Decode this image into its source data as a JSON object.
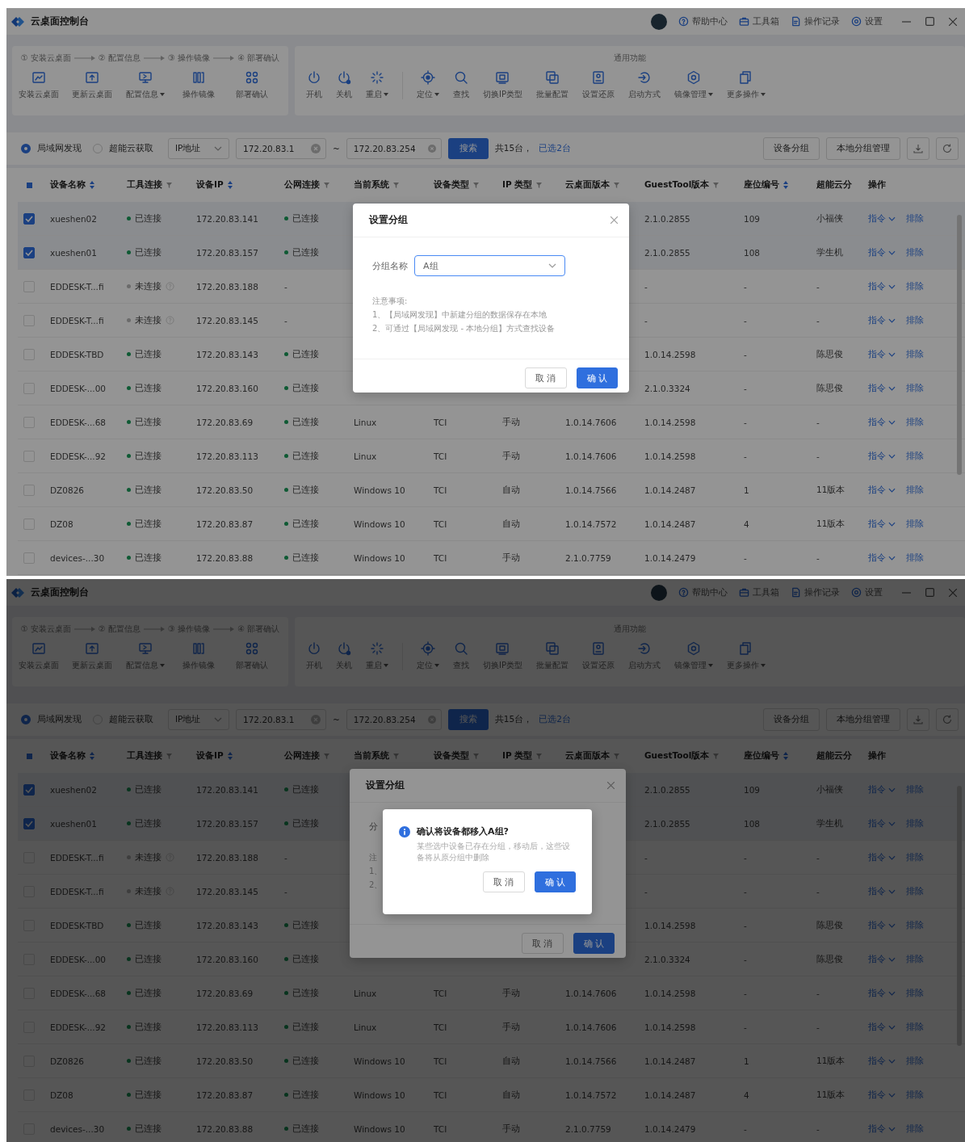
{
  "screens": [
    {
      "window": {
        "title": "云桌面控制台",
        "links": [
          "帮助中心",
          "工具箱",
          "操作记录",
          "设置"
        ]
      },
      "deploy": {
        "steps": [
          "① 安装云桌面",
          "② 配置信息",
          "③ 操作镜像",
          "④ 部署确认"
        ],
        "buttons": [
          {
            "label": "安装云桌面",
            "dropdown": false
          },
          {
            "label": "更新云桌面",
            "dropdown": false
          },
          {
            "label": "配置信息",
            "dropdown": true
          },
          {
            "label": "操作镜像",
            "dropdown": false
          },
          {
            "label": "部署确认",
            "dropdown": false
          }
        ]
      },
      "common": {
        "title": "通用功能",
        "groups": [
          [
            {
              "label": "开机",
              "dropdown": false
            },
            {
              "label": "关机",
              "dropdown": false
            },
            {
              "label": "重启",
              "dropdown": true
            }
          ],
          [
            {
              "label": "定位",
              "dropdown": true
            },
            {
              "label": "查找",
              "dropdown": false
            },
            {
              "label": "切换IP类型",
              "dropdown": false
            },
            {
              "label": "批量配置",
              "dropdown": false
            },
            {
              "label": "设置还原",
              "dropdown": false
            },
            {
              "label": "启动方式",
              "dropdown": false
            },
            {
              "label": "镜像管理",
              "dropdown": true
            },
            {
              "label": "更多操作",
              "dropdown": true
            }
          ]
        ]
      },
      "filter": {
        "sources": [
          {
            "label": "局域网发现",
            "selected": true
          },
          {
            "label": "超能云获取",
            "selected": false
          }
        ],
        "field": "IP地址",
        "ip_from": "172.20.83.1",
        "separator": "~",
        "ip_to": "172.20.83.254",
        "search": "搜索",
        "total": "共15台，",
        "selected_count": "已选2台",
        "buttons": [
          "设备分组",
          "本地分组管理"
        ]
      },
      "table": {
        "header_indeterminate": true,
        "columns": [
          {
            "label": "设备名称",
            "kind": "sort"
          },
          {
            "label": "工具连接",
            "kind": "filter"
          },
          {
            "label": "设备IP",
            "kind": "sort"
          },
          {
            "label": "公网连接",
            "kind": "filter"
          },
          {
            "label": "当前系统",
            "kind": "filter"
          },
          {
            "label": "设备类型",
            "kind": "filter"
          },
          {
            "label": "IP 类型",
            "kind": "filter"
          },
          {
            "label": "云桌面版本",
            "kind": "filter"
          },
          {
            "label": "GuestTool版本",
            "kind": "filter"
          },
          {
            "label": "座位编号",
            "kind": "sort"
          },
          {
            "label": "超能云分",
            "kind": "plain"
          },
          {
            "label": "操作",
            "kind": "plain"
          }
        ],
        "rows": [
          {
            "selected": true,
            "name": "xueshen02",
            "tool": {
              "label": "已连接",
              "kind": "connected"
            },
            "ip": "172.20.83.141",
            "public": {
              "label": "已连接",
              "kind": "connected"
            },
            "guest_tool": "2.1.0.2855",
            "seat": "109",
            "cloud_group": "小福侠",
            "actions": [
              "指令",
              "排除"
            ]
          },
          {
            "selected": true,
            "name": "xueshen01",
            "tool": {
              "label": "已连接",
              "kind": "connected"
            },
            "ip": "172.20.83.157",
            "public": {
              "label": "已连接",
              "kind": "connected"
            },
            "guest_tool": "2.1.0.2855",
            "seat": "108",
            "cloud_group": "学生机",
            "actions": [
              "指令",
              "排除"
            ]
          },
          {
            "selected": false,
            "name": "EDDESK-T...fi",
            "tool": {
              "label": "未连接",
              "kind": "disconnected"
            },
            "ip": "172.20.83.188",
            "public": {
              "label": "-",
              "kind": "none"
            },
            "guest_tool": "-",
            "seat": "-",
            "cloud_group": "-",
            "actions": [
              "指令",
              "排除"
            ]
          },
          {
            "selected": false,
            "name": "EDDESK-T...fi",
            "tool": {
              "label": "未连接",
              "kind": "disconnected"
            },
            "ip": "172.20.83.145",
            "public": {
              "label": "-",
              "kind": "none"
            },
            "guest_tool": "-",
            "seat": "-",
            "cloud_group": "-",
            "actions": [
              "指令",
              "排除"
            ]
          },
          {
            "selected": false,
            "name": "EDDESK-TBD",
            "tool": {
              "label": "已连接",
              "kind": "connected"
            },
            "ip": "172.20.83.143",
            "public": {
              "label": "已连接",
              "kind": "connected"
            },
            "guest_tool": "1.0.14.2598",
            "seat": "-",
            "cloud_group": "陈思俊",
            "actions": [
              "指令",
              "排除"
            ]
          },
          {
            "selected": false,
            "name": "EDDESK-...00",
            "tool": {
              "label": "已连接",
              "kind": "connected"
            },
            "ip": "172.20.83.160",
            "public": {
              "label": "已连接",
              "kind": "connected"
            },
            "guest_tool": "2.1.0.3324",
            "seat": "-",
            "cloud_group": "陈思俊",
            "actions": [
              "指令",
              "排除"
            ]
          },
          {
            "selected": false,
            "name": "EDDESK-...68",
            "tool": {
              "label": "已连接",
              "kind": "connected"
            },
            "ip": "172.20.83.69",
            "public": {
              "label": "已连接",
              "kind": "connected"
            },
            "system": "Linux",
            "type": "TCI",
            "ip_type": "手动",
            "version": "1.0.14.7606",
            "guest_tool": "1.0.14.2598",
            "seat": "-",
            "cloud_group": "-",
            "actions": [
              "指令",
              "排除"
            ]
          },
          {
            "selected": false,
            "name": "EDDESK-...92",
            "tool": {
              "label": "已连接",
              "kind": "connected"
            },
            "ip": "172.20.83.113",
            "public": {
              "label": "已连接",
              "kind": "connected"
            },
            "system": "Linux",
            "type": "TCI",
            "ip_type": "手动",
            "version": "1.0.14.7606",
            "guest_tool": "1.0.14.2598",
            "seat": "-",
            "cloud_group": "-",
            "actions": [
              "指令",
              "排除"
            ]
          },
          {
            "selected": false,
            "name": "DZ0826",
            "tool": {
              "label": "已连接",
              "kind": "connected"
            },
            "ip": "172.20.83.50",
            "public": {
              "label": "已连接",
              "kind": "connected"
            },
            "system": "Windows 10",
            "type": "TCI",
            "ip_type": "自动",
            "version": "1.0.14.7566",
            "guest_tool": "1.0.14.2487",
            "seat": "1",
            "cloud_group": "11版本",
            "actions": [
              "指令",
              "排除"
            ]
          },
          {
            "selected": false,
            "name": "DZ08",
            "tool": {
              "label": "已连接",
              "kind": "connected"
            },
            "ip": "172.20.83.87",
            "public": {
              "label": "已连接",
              "kind": "connected"
            },
            "system": "Windows 10",
            "type": "TCI",
            "ip_type": "自动",
            "version": "1.0.14.7572",
            "guest_tool": "1.0.14.2487",
            "seat": "4",
            "cloud_group": "11版本",
            "actions": [
              "指令",
              "排除"
            ]
          },
          {
            "selected": false,
            "name": "devices-...30",
            "tool": {
              "label": "已连接",
              "kind": "connected"
            },
            "ip": "172.20.83.88",
            "public": {
              "label": "已连接",
              "kind": "connected"
            },
            "system": "Windows 10",
            "type": "TCI",
            "ip_type": "手动",
            "version": "2.1.0.7759",
            "guest_tool": "1.0.14.2479",
            "seat": "-",
            "cloud_group": "-",
            "actions": [
              "指令",
              "排除"
            ]
          }
        ]
      },
      "dialog": {
        "title": "设置分组",
        "label": "分组名称",
        "value": "A组",
        "notes": [
          "注意事项:",
          "1、【局域网发现】中新建分组的数据保存在本地",
          "2、可通过【局域网发现 - 本地分组】方式查找设备"
        ],
        "buttons": [
          "取 消",
          "确 认"
        ]
      }
    },
    {
      "window": {
        "title": "云桌面控制台",
        "links": [
          "帮助中心",
          "工具箱",
          "操作记录",
          "设置"
        ]
      },
      "deploy": {
        "steps": [
          "① 安装云桌面",
          "② 配置信息",
          "③ 操作镜像",
          "④ 部署确认"
        ],
        "buttons": [
          {
            "label": "安装云桌面",
            "dropdown": false
          },
          {
            "label": "更新云桌面",
            "dropdown": false
          },
          {
            "label": "配置信息",
            "dropdown": true
          },
          {
            "label": "操作镜像",
            "dropdown": false
          },
          {
            "label": "部署确认",
            "dropdown": false
          }
        ]
      },
      "common": {
        "title": "通用功能",
        "groups": [
          [
            {
              "label": "开机",
              "dropdown": false
            },
            {
              "label": "关机",
              "dropdown": false
            },
            {
              "label": "重启",
              "dropdown": true
            }
          ],
          [
            {
              "label": "定位",
              "dropdown": true
            },
            {
              "label": "查找",
              "dropdown": false
            },
            {
              "label": "切换IP类型",
              "dropdown": false
            },
            {
              "label": "批量配置",
              "dropdown": false
            },
            {
              "label": "设置还原",
              "dropdown": false
            },
            {
              "label": "启动方式",
              "dropdown": false
            },
            {
              "label": "镜像管理",
              "dropdown": true
            },
            {
              "label": "更多操作",
              "dropdown": true
            }
          ]
        ]
      },
      "filter": {
        "sources": [
          {
            "label": "局域网发现",
            "selected": true
          },
          {
            "label": "超能云获取",
            "selected": false
          }
        ],
        "field": "IP地址",
        "ip_from": "172.20.83.1",
        "separator": "~",
        "ip_to": "172.20.83.254",
        "search": "搜索",
        "total": "共15台，",
        "selected_count": "已选2台",
        "buttons": [
          "设备分组",
          "本地分组管理"
        ]
      },
      "table": {
        "header_indeterminate": true,
        "columns": [
          {
            "label": "设备名称",
            "kind": "sort"
          },
          {
            "label": "工具连接",
            "kind": "filter"
          },
          {
            "label": "设备IP",
            "kind": "sort"
          },
          {
            "label": "公网连接",
            "kind": "filter"
          },
          {
            "label": "当前系统",
            "kind": "filter"
          },
          {
            "label": "设备类型",
            "kind": "filter"
          },
          {
            "label": "IP 类型",
            "kind": "filter"
          },
          {
            "label": "云桌面版本",
            "kind": "filter"
          },
          {
            "label": "GuestTool版本",
            "kind": "filter"
          },
          {
            "label": "座位编号",
            "kind": "sort"
          },
          {
            "label": "超能云分",
            "kind": "plain"
          },
          {
            "label": "操作",
            "kind": "plain"
          }
        ],
        "rows": [
          {
            "selected": true,
            "name": "xueshen02",
            "tool": {
              "label": "已连接",
              "kind": "connected"
            },
            "ip": "172.20.83.141",
            "public": {
              "label": "已连接",
              "kind": "connected"
            },
            "guest_tool": "2.1.0.2855",
            "seat": "109",
            "cloud_group": "小福侠",
            "actions": [
              "指令",
              "排除"
            ]
          },
          {
            "selected": true,
            "name": "xueshen01",
            "tool": {
              "label": "已连接",
              "kind": "connected"
            },
            "ip": "172.20.83.157",
            "public": {
              "label": "已连接",
              "kind": "connected"
            },
            "guest_tool": "2.1.0.2855",
            "seat": "108",
            "cloud_group": "学生机",
            "actions": [
              "指令",
              "排除"
            ]
          },
          {
            "selected": false,
            "name": "EDDESK-T...fi",
            "tool": {
              "label": "未连接",
              "kind": "disconnected"
            },
            "ip": "172.20.83.188",
            "public": {
              "label": "-",
              "kind": "none"
            },
            "guest_tool": "-",
            "seat": "-",
            "cloud_group": "-",
            "actions": [
              "指令",
              "排除"
            ]
          },
          {
            "selected": false,
            "name": "EDDESK-T...fi",
            "tool": {
              "label": "未连接",
              "kind": "disconnected"
            },
            "ip": "172.20.83.145",
            "public": {
              "label": "-",
              "kind": "none"
            },
            "guest_tool": "-",
            "seat": "-",
            "cloud_group": "-",
            "actions": [
              "指令",
              "排除"
            ]
          },
          {
            "selected": false,
            "name": "EDDESK-TBD",
            "tool": {
              "label": "已连接",
              "kind": "connected"
            },
            "ip": "172.20.83.143",
            "public": {
              "label": "已连接",
              "kind": "connected"
            },
            "guest_tool": "1.0.14.2598",
            "seat": "-",
            "cloud_group": "陈思俊",
            "actions": [
              "指令",
              "排除"
            ]
          },
          {
            "selected": false,
            "name": "EDDESK-...00",
            "tool": {
              "label": "已连接",
              "kind": "connected"
            },
            "ip": "172.20.83.160",
            "public": {
              "label": "已连接",
              "kind": "connected"
            },
            "guest_tool": "2.1.0.3324",
            "seat": "-",
            "cloud_group": "陈思俊",
            "actions": [
              "指令",
              "排除"
            ]
          },
          {
            "selected": false,
            "name": "EDDESK-...68",
            "tool": {
              "label": "已连接",
              "kind": "connected"
            },
            "ip": "172.20.83.69",
            "public": {
              "label": "已连接",
              "kind": "connected"
            },
            "system": "Linux",
            "type": "TCI",
            "ip_type": "手动",
            "version": "1.0.14.7606",
            "guest_tool": "1.0.14.2598",
            "seat": "-",
            "cloud_group": "-",
            "actions": [
              "指令",
              "排除"
            ]
          },
          {
            "selected": false,
            "name": "EDDESK-...92",
            "tool": {
              "label": "已连接",
              "kind": "connected"
            },
            "ip": "172.20.83.113",
            "public": {
              "label": "已连接",
              "kind": "connected"
            },
            "system": "Linux",
            "type": "TCI",
            "ip_type": "手动",
            "version": "1.0.14.7606",
            "guest_tool": "1.0.14.2598",
            "seat": "-",
            "cloud_group": "-",
            "actions": [
              "指令",
              "排除"
            ]
          },
          {
            "selected": false,
            "name": "DZ0826",
            "tool": {
              "label": "已连接",
              "kind": "connected"
            },
            "ip": "172.20.83.50",
            "public": {
              "label": "已连接",
              "kind": "connected"
            },
            "system": "Windows 10",
            "type": "TCI",
            "ip_type": "自动",
            "version": "1.0.14.7566",
            "guest_tool": "1.0.14.2487",
            "seat": "1",
            "cloud_group": "11版本",
            "actions": [
              "指令",
              "排除"
            ]
          },
          {
            "selected": false,
            "name": "DZ08",
            "tool": {
              "label": "已连接",
              "kind": "connected"
            },
            "ip": "172.20.83.87",
            "public": {
              "label": "已连接",
              "kind": "connected"
            },
            "system": "Windows 10",
            "type": "TCI",
            "ip_type": "自动",
            "version": "1.0.14.7572",
            "guest_tool": "1.0.14.2487",
            "seat": "4",
            "cloud_group": "11版本",
            "actions": [
              "指令",
              "排除"
            ]
          },
          {
            "selected": false,
            "name": "devices-...30",
            "tool": {
              "label": "已连接",
              "kind": "connected"
            },
            "ip": "172.20.83.88",
            "public": {
              "label": "已连接",
              "kind": "connected"
            },
            "system": "Windows 10",
            "type": "TCI",
            "ip_type": "手动",
            "version": "2.1.0.7759",
            "guest_tool": "1.0.14.2479",
            "seat": "-",
            "cloud_group": "-",
            "actions": [
              "指令",
              "排除"
            ]
          }
        ]
      },
      "dialog": {
        "title": "设置分组",
        "label": "分",
        "notes": [
          "注",
          "1、",
          "2、"
        ],
        "buttons": [
          "取 消",
          "确 认"
        ]
      },
      "confirm": {
        "title": "确认将设备都移入A组?",
        "message": "某些选中设备已存在分组，移动后，这些设备将从原分组中删除",
        "buttons": [
          "取 消",
          "确 认"
        ]
      }
    }
  ]
}
